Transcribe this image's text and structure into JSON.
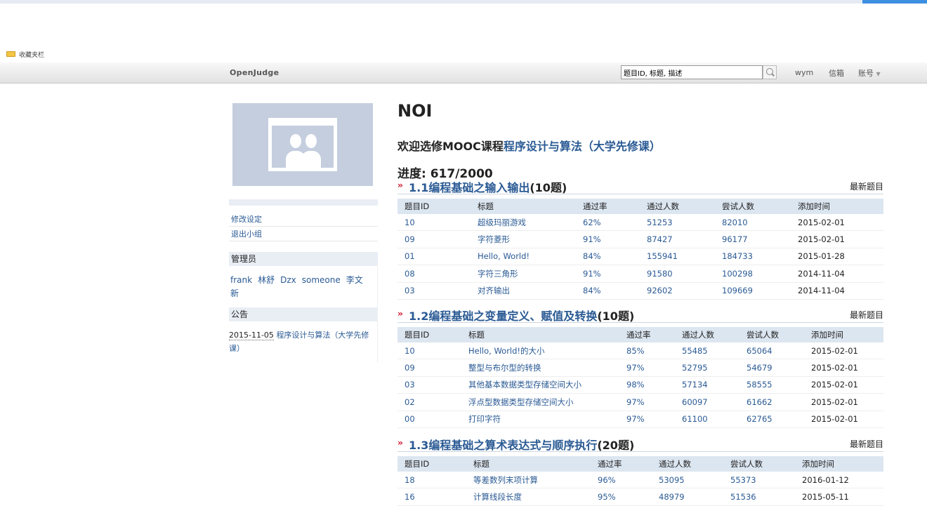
{
  "bookmarks": {
    "label": "收藏夹栏"
  },
  "navbar": {
    "brand": "OpenJudge",
    "search_value": "题目ID, 标题, 描述",
    "user": "wym",
    "mail": "信箱",
    "account": "账号"
  },
  "sidebar": {
    "links": [
      "修改设定",
      "退出小组"
    ],
    "admins_heading": "管理员",
    "admins": [
      "frank",
      "林舒",
      "Dzx",
      "someone",
      "李文新"
    ],
    "notice_heading": "公告",
    "notice": {
      "date": "2015-11-05",
      "text": "程序设计与算法（大学先修课）"
    }
  },
  "main": {
    "title": "NOI",
    "welcome_prefix": "欢迎选修MOOC课程",
    "welcome_link": "程序设计与算法（大学先修课）",
    "progress": "进度: 617/2000"
  },
  "sections": [
    {
      "title": "1.1编程基础之输入输出",
      "count": "(10题)",
      "latest": "最新题目",
      "headers": [
        "题目ID",
        "标题",
        "通过率",
        "通过人数",
        "尝试人数",
        "添加时间"
      ],
      "rows": [
        [
          "10",
          "超级玛丽游戏",
          "62%",
          "51253",
          "82010",
          "2015-02-01"
        ],
        [
          "09",
          "字符菱形",
          "91%",
          "87427",
          "96177",
          "2015-02-01"
        ],
        [
          "01",
          "Hello, World!",
          "84%",
          "155941",
          "184733",
          "2015-01-28"
        ],
        [
          "08",
          "字符三角形",
          "91%",
          "91580",
          "100298",
          "2014-11-04"
        ],
        [
          "03",
          "对齐输出",
          "84%",
          "92602",
          "109669",
          "2014-11-04"
        ]
      ]
    },
    {
      "title": "1.2编程基础之变量定义、赋值及转换",
      "count": "(10题)",
      "latest": "最新题目",
      "headers": [
        "题目ID",
        "标题",
        "通过率",
        "通过人数",
        "尝试人数",
        "添加时间"
      ],
      "rows": [
        [
          "10",
          "Hello, World!的大小",
          "85%",
          "55485",
          "65064",
          "2015-02-01"
        ],
        [
          "09",
          "整型与布尔型的转换",
          "97%",
          "52795",
          "54679",
          "2015-02-01"
        ],
        [
          "03",
          "其他基本数据类型存储空间大小",
          "98%",
          "57134",
          "58555",
          "2015-02-01"
        ],
        [
          "02",
          "浮点型数据类型存储空间大小",
          "97%",
          "60097",
          "61662",
          "2015-02-01"
        ],
        [
          "00",
          "打印字符",
          "97%",
          "61100",
          "62765",
          "2015-02-01"
        ]
      ]
    },
    {
      "title": "1.3编程基础之算术表达式与顺序执行",
      "count": "(20题)",
      "latest": "最新题目",
      "headers": [
        "题目ID",
        "标题",
        "通过率",
        "通过人数",
        "尝试人数",
        "添加时间"
      ],
      "rows": [
        [
          "18",
          "等差数列末项计算",
          "96%",
          "53095",
          "55373",
          "2016-01-12"
        ],
        [
          "16",
          "计算线段长度",
          "95%",
          "48979",
          "51536",
          "2015-05-11"
        ]
      ]
    }
  ]
}
